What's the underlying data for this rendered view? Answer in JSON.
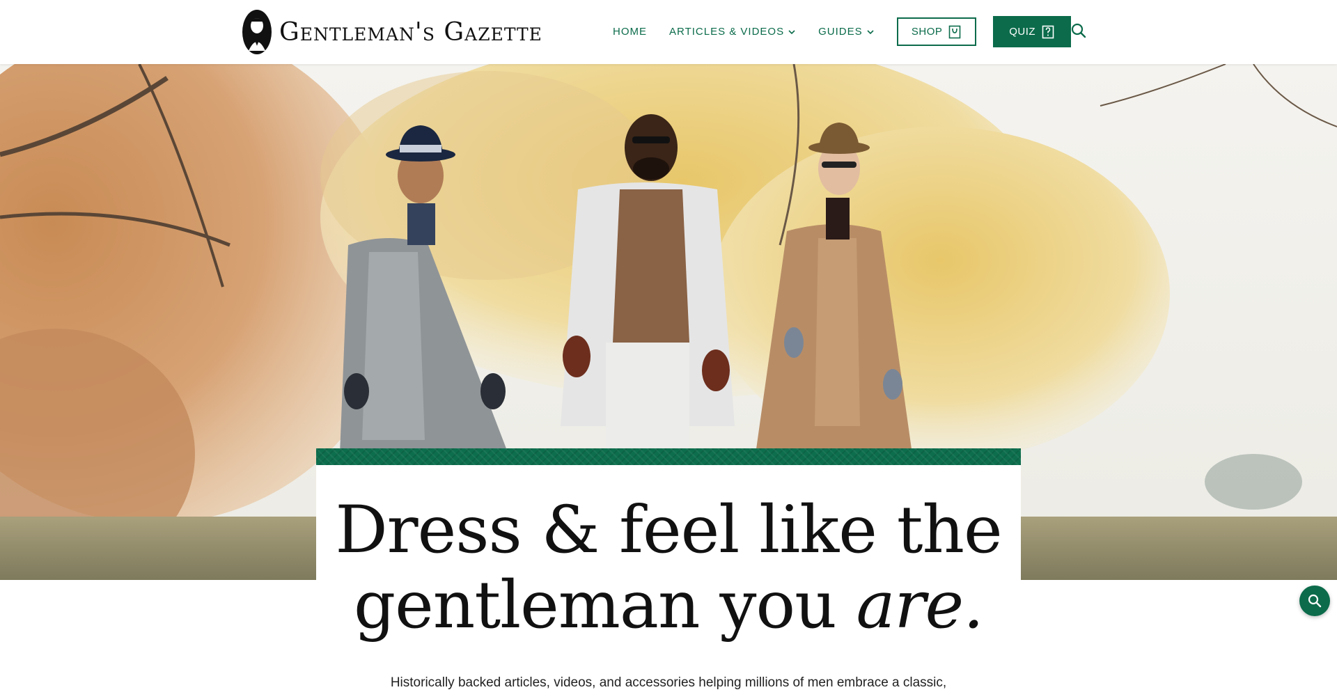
{
  "brand": {
    "name": "Gentleman's Gazette",
    "logo_icon": "gentleman-portrait-icon",
    "accent_color": "#0b6b4b"
  },
  "nav": {
    "home": "HOME",
    "articles": "ARTICLES & VIDEOS",
    "guides": "GUIDES",
    "shop": "SHOP",
    "quiz": "QUIZ",
    "search_icon": "search-icon"
  },
  "hero": {
    "image_alt": "Three gentlemen in overcoats walking through an autumn park"
  },
  "card": {
    "headline_line1": "Dress & feel like the",
    "headline_line2_plain": "gentleman you ",
    "headline_line2_em": "are.",
    "subtext": "Historically backed articles, videos, and accessories helping millions of men embrace a classic,"
  },
  "fab": {
    "icon": "search-icon"
  }
}
